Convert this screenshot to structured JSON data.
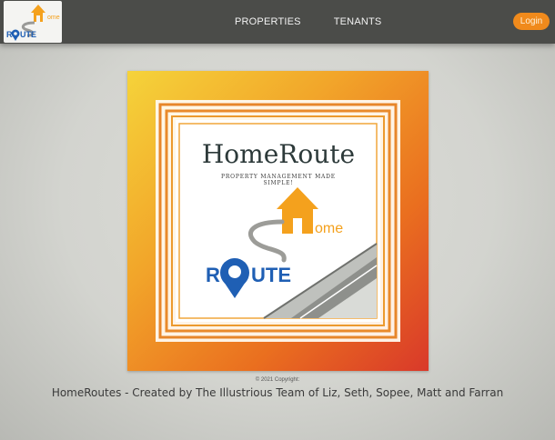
{
  "nav": {
    "links": [
      "PROPERTIES",
      "TENANTS"
    ],
    "login_label": "Login",
    "logo": {
      "home_letters": "ome",
      "route_r": "R",
      "route_rest": "UTE"
    }
  },
  "hero": {
    "title": "HomeRoute",
    "tagline_line1": "PROPERTY MANAGEMENT MADE",
    "tagline_line2": "SIMPLE!",
    "logo_home_text": "ome",
    "logo_route_r": "R",
    "logo_route_rest": "UTE"
  },
  "footer": {
    "copyright": "© 2021 Copyright:",
    "credits": "HomeRoutes - Created by The Illustrious Team of Liz, Seth, Sopee, Matt and Farran"
  },
  "colors": {
    "navbar": "#4b4c49",
    "accent_orange": "#f08a1c",
    "route_blue": "#1f5fb4"
  }
}
